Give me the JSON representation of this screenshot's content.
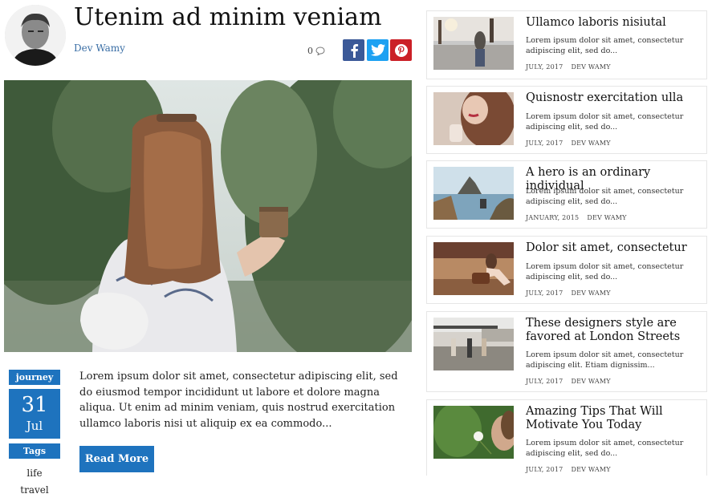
{
  "post": {
    "title": "Utenim ad minim veniam",
    "author": "Dev Wamy",
    "comments": "0",
    "excerpt": "Lorem ipsum dolor sit amet, consectetur adipiscing elit, sed do eiusmod tempor incididunt ut labore et dolore magna aliqua. Ut enim ad minim veniam, quis nostrud exercitation ullamco laboris nisi ut aliquip ex ea commodo...",
    "read_more": "Read More",
    "category": "journey",
    "day": "31",
    "month": "Jul",
    "tags_label": "Tags",
    "tags": [
      "life",
      "travel"
    ]
  },
  "share": {
    "facebook": "f",
    "twitter": "twitter-icon",
    "pinterest": "pinterest-icon"
  },
  "colors": {
    "accent": "#1e73be",
    "facebook": "#3b5998",
    "twitter": "#1da1f2",
    "pinterest": "#cb2027"
  },
  "sidebar": {
    "items": [
      {
        "title": "Ullamco laboris nisiutal",
        "excerpt": "Lorem ipsum dolor sit amet, consectetur adipiscing elit, sed do...",
        "date": "JULY, 2017",
        "author": "DEV WAMY"
      },
      {
        "title": "Quisnostr exercitation ulla",
        "excerpt": "Lorem ipsum dolor sit amet, consectetur adipiscing elit, sed do...",
        "date": "JULY, 2017",
        "author": "DEV WAMY"
      },
      {
        "title": "A hero is an ordinary individual",
        "excerpt": "Lorem ipsum dolor sit amet, consectetur adipiscing elit, sed do...",
        "date": "JANUARY, 2015",
        "author": "DEV WAMY"
      },
      {
        "title": "Dolor sit amet, consectetur",
        "excerpt": "Lorem ipsum dolor sit amet, consectetur adipiscing elit, sed do...",
        "date": "JULY, 2017",
        "author": "DEV WAMY"
      },
      {
        "title": "These designers style are favored at London Streets",
        "excerpt": "Lorem ipsum dolor sit amet, consectetur adipiscing elit. Etiam dignissim...",
        "date": "JULY, 2017",
        "author": "DEV WAMY"
      },
      {
        "title": "Amazing Tips That Will Motivate You Today",
        "excerpt": "Lorem ipsum dolor sit amet, consectetur adipiscing elit, sed do...",
        "date": "JULY, 2017",
        "author": "DEV WAMY"
      }
    ]
  }
}
